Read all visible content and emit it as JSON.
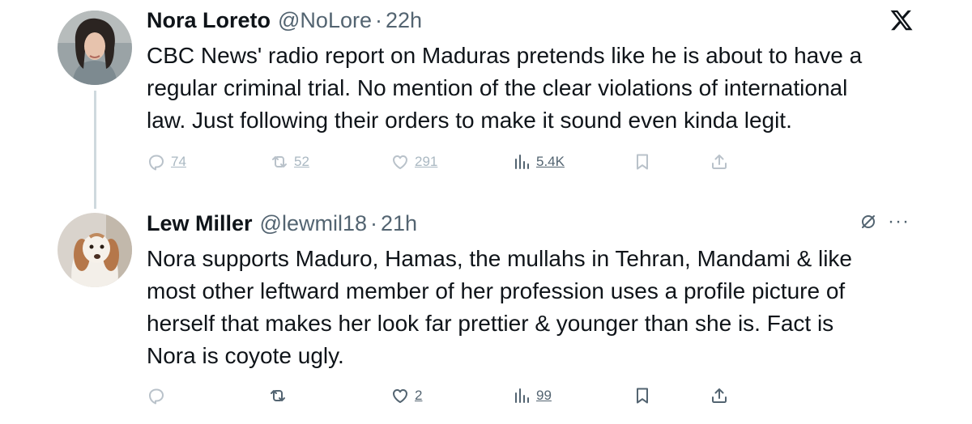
{
  "tweets": [
    {
      "display_name": "Nora Loreto",
      "handle": "@NoLore",
      "separator": "·",
      "time": "22h",
      "text": "CBC News' radio report on Maduras pretends like he is about to have a\nregular criminal trial. No mention of the clear violations of international\nlaw. Just following their orders to make it sound even kinda legit.",
      "replies": "74",
      "reposts": "52",
      "likes": "291",
      "views": "5.4K"
    },
    {
      "display_name": "Lew Miller",
      "handle": "@lewmil18",
      "separator": "·",
      "time": "21h",
      "text": "Nora supports Maduro, Hamas, the mullahs in  Tehran, Mandami & like\nmost other leftward member of her profession uses a profile picture of\nherself that makes her look far prettier & younger than she is. Fact is\nNora is coyote ugly.",
      "replies": "",
      "reposts": "",
      "likes": "2",
      "views": "99",
      "more": "···"
    }
  ],
  "icons": {
    "logo": "x-logo",
    "reply": "reply-icon",
    "repost": "repost-icon",
    "like": "heart-icon",
    "views": "views-icon",
    "bookmark": "bookmark-icon",
    "share": "share-icon",
    "grok": "slashed-circle-icon",
    "more": "more-icon"
  },
  "colors": {
    "text": "#0f1419",
    "secondary": "#536471",
    "thread_line": "#cfd9de"
  }
}
